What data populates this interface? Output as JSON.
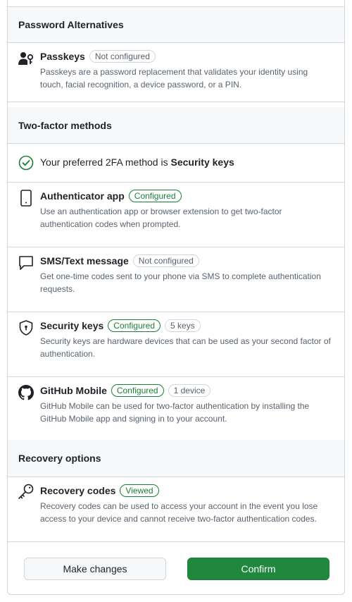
{
  "sections": {
    "password_alternatives": "Password Alternatives",
    "two_factor": "Two-factor methods",
    "recovery": "Recovery options"
  },
  "passkeys": {
    "title": "Passkeys",
    "badge": "Not configured",
    "desc": "Passkeys are a password replacement that validates your identity using touch, facial recognition, a device password, or a PIN.",
    "icon": "passkey-icon"
  },
  "preferred": {
    "prefix": "Your preferred 2FA method is ",
    "method": "Security keys",
    "icon": "check-circle-icon"
  },
  "authenticator": {
    "title": "Authenticator app",
    "badge": "Configured",
    "desc": "Use an authentication app or browser extension to get two-factor authentication codes when prompted.",
    "icon": "device-mobile-icon"
  },
  "sms": {
    "title": "SMS/Text message",
    "badge": "Not configured",
    "desc": "Get one-time codes sent to your phone via SMS to complete authentication requests.",
    "icon": "comment-icon"
  },
  "security_keys": {
    "title": "Security keys",
    "badge": "Configured",
    "count_badge": "5 keys",
    "desc": "Security keys are hardware devices that can be used as your second factor of authentication.",
    "icon": "shield-lock-icon"
  },
  "github_mobile": {
    "title": "GitHub Mobile",
    "badge": "Configured",
    "count_badge": "1 device",
    "desc": "GitHub Mobile can be used for two-factor authentication by installing the GitHub Mobile app and signing in to your account.",
    "icon": "github-mark-icon"
  },
  "recovery_codes": {
    "title": "Recovery codes",
    "badge": "Viewed",
    "desc": "Recovery codes can be used to access your account in the event you lose access to your device and cannot receive two-factor authentication codes.",
    "icon": "key-icon"
  },
  "buttons": {
    "make_changes": "Make changes",
    "confirm": "Confirm"
  },
  "colors": {
    "border": "#d0d7de",
    "header_bg": "#f6f8fa",
    "success": "#1a7f37",
    "primary_button": "#1f883d",
    "muted_text": "#59636e"
  }
}
